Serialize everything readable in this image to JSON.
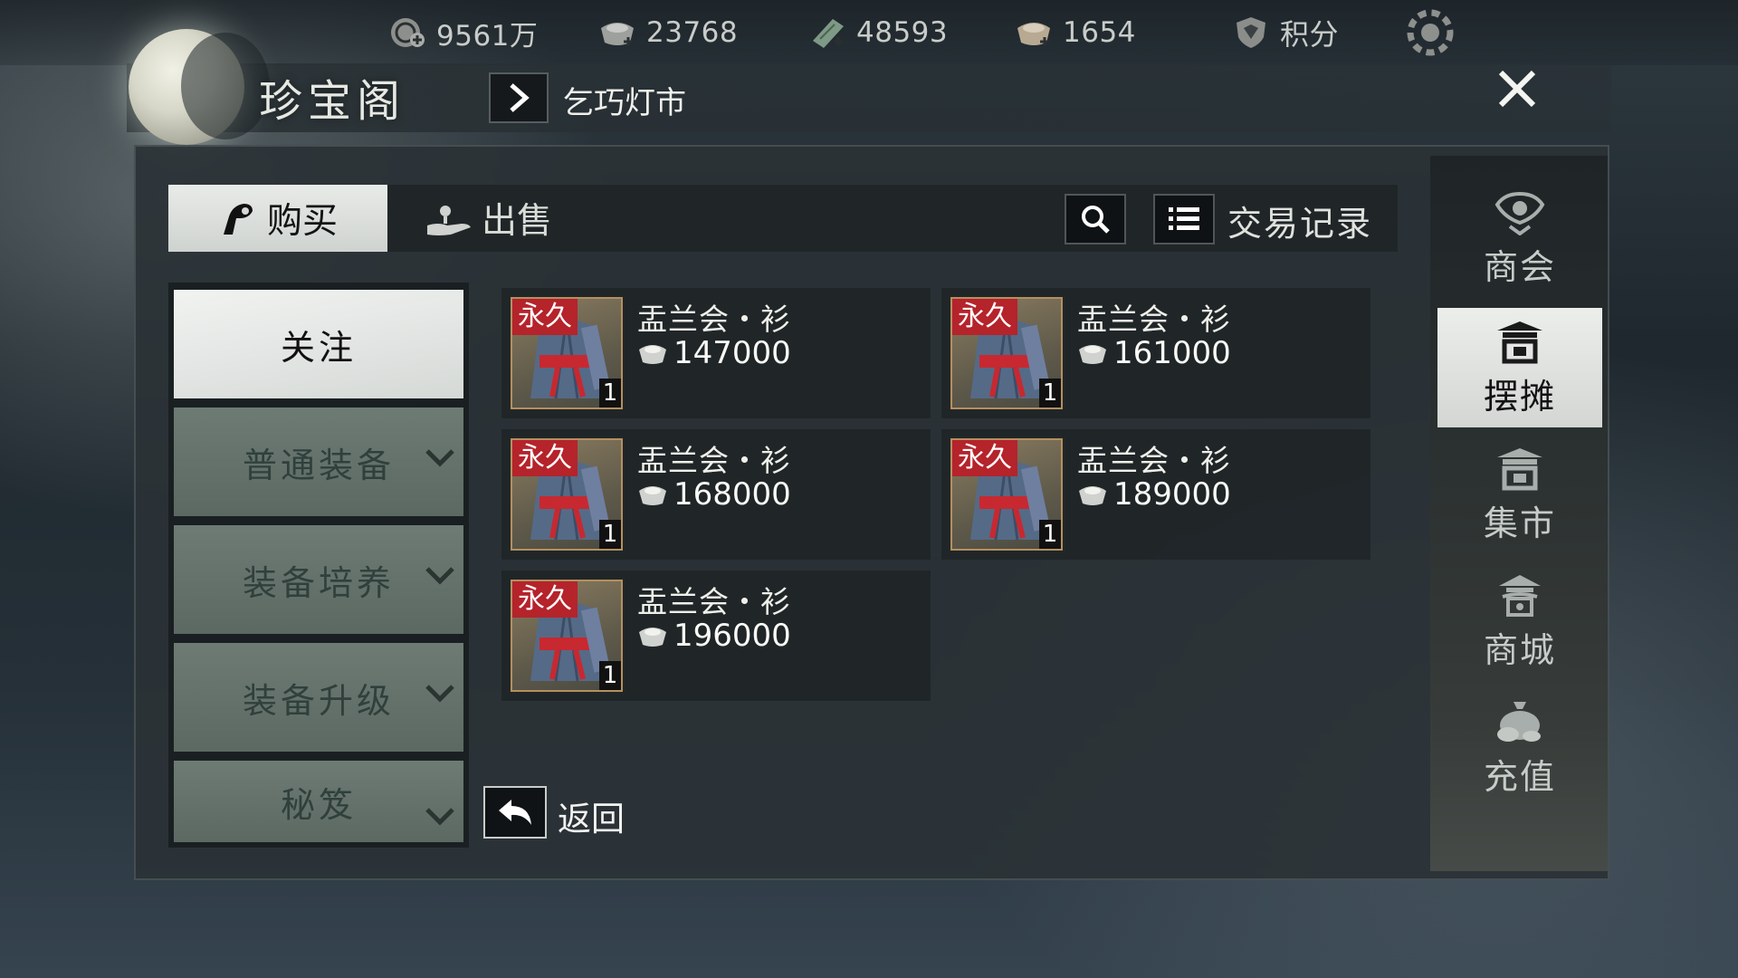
{
  "currencies": [
    {
      "icon": "coin-plus-icon",
      "value": "9561万"
    },
    {
      "icon": "silver-ingot-icon",
      "value": "23768"
    },
    {
      "icon": "jade-ticket-icon",
      "value": "48593"
    },
    {
      "icon": "ingot-plus-icon",
      "value": "1654"
    },
    {
      "icon": "shield-points-icon",
      "value": "积分"
    }
  ],
  "header": {
    "title": "珍宝阁",
    "breadcrumb": "乞巧灯市"
  },
  "tabs": {
    "buy": "购买",
    "sell": "出售",
    "records": "交易记录"
  },
  "categories": [
    {
      "label": "关注",
      "active": true
    },
    {
      "label": "普通装备",
      "expandable": true
    },
    {
      "label": "装备培养",
      "expandable": true
    },
    {
      "label": "装备升级",
      "expandable": true
    },
    {
      "label": "秘笈",
      "expandable": true
    }
  ],
  "items": [
    {
      "name": "盂兰会・衫",
      "price": "147000",
      "badge": "永久",
      "qty": "1"
    },
    {
      "name": "盂兰会・衫",
      "price": "161000",
      "badge": "永久",
      "qty": "1"
    },
    {
      "name": "盂兰会・衫",
      "price": "168000",
      "badge": "永久",
      "qty": "1"
    },
    {
      "name": "盂兰会・衫",
      "price": "189000",
      "badge": "永久",
      "qty": "1"
    },
    {
      "name": "盂兰会・衫",
      "price": "196000",
      "badge": "永久",
      "qty": "1"
    }
  ],
  "back_label": "返回",
  "right_nav": [
    {
      "label": "商会",
      "icon": "guild-emblem-icon"
    },
    {
      "label": "摆摊",
      "icon": "stall-icon",
      "active": true
    },
    {
      "label": "集市",
      "icon": "market-icon"
    },
    {
      "label": "商城",
      "icon": "shop-pavilion-icon"
    },
    {
      "label": "充值",
      "icon": "money-bag-icon"
    }
  ],
  "colors": {
    "accent_red": "#b5232b",
    "panel": "#2a3236",
    "active_tab": "#e8ebe8",
    "category": "#6d7b74"
  }
}
